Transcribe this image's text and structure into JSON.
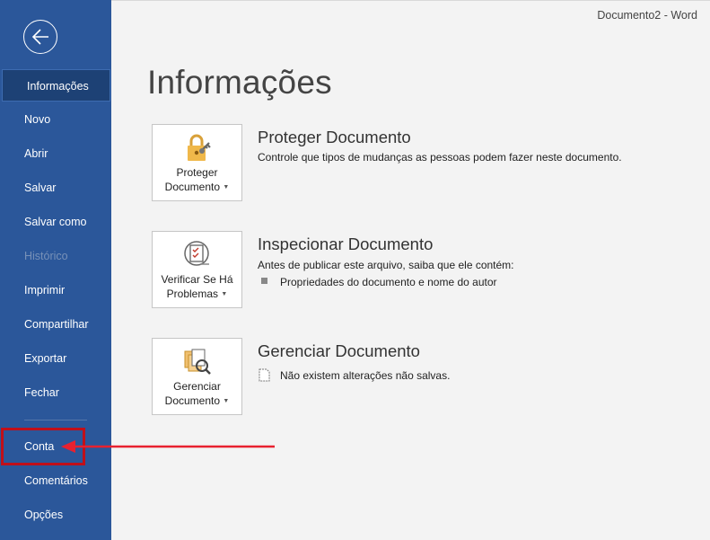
{
  "window": {
    "title": "Documento2 - Word"
  },
  "sidebar": {
    "back_label": "",
    "items": [
      {
        "label": "Informações"
      },
      {
        "label": "Novo"
      },
      {
        "label": "Abrir"
      },
      {
        "label": "Salvar"
      },
      {
        "label": "Salvar como"
      },
      {
        "label": "Histórico"
      },
      {
        "label": "Imprimir"
      },
      {
        "label": "Compartilhar"
      },
      {
        "label": "Exportar"
      },
      {
        "label": "Fechar"
      },
      {
        "label": "Conta"
      },
      {
        "label": "Comentários"
      },
      {
        "label": "Opções"
      }
    ]
  },
  "main": {
    "title": "Informações",
    "sections": [
      {
        "button_line1": "Proteger",
        "button_line2": "Documento",
        "icon": "lock-icon",
        "title": "Proteger Documento",
        "description": "Controle que tipos de mudanças as pessoas podem fazer neste documento."
      },
      {
        "button_line1": "Verificar Se Há",
        "button_line2": "Problemas",
        "icon": "inspect-document-icon",
        "title": "Inspecionar Documento",
        "description": "Antes de publicar este arquivo, saiba que ele contém:",
        "bullet": "Propriedades do documento e nome do autor"
      },
      {
        "button_line1": "Gerenciar",
        "button_line2": "Documento",
        "icon": "manage-document-icon",
        "title": "Gerenciar Documento",
        "note": "Não existem alterações não salvas."
      }
    ]
  },
  "colors": {
    "sidebar": "#2b579a",
    "active_item": "#1d4175",
    "annotation": "#e8212f"
  }
}
